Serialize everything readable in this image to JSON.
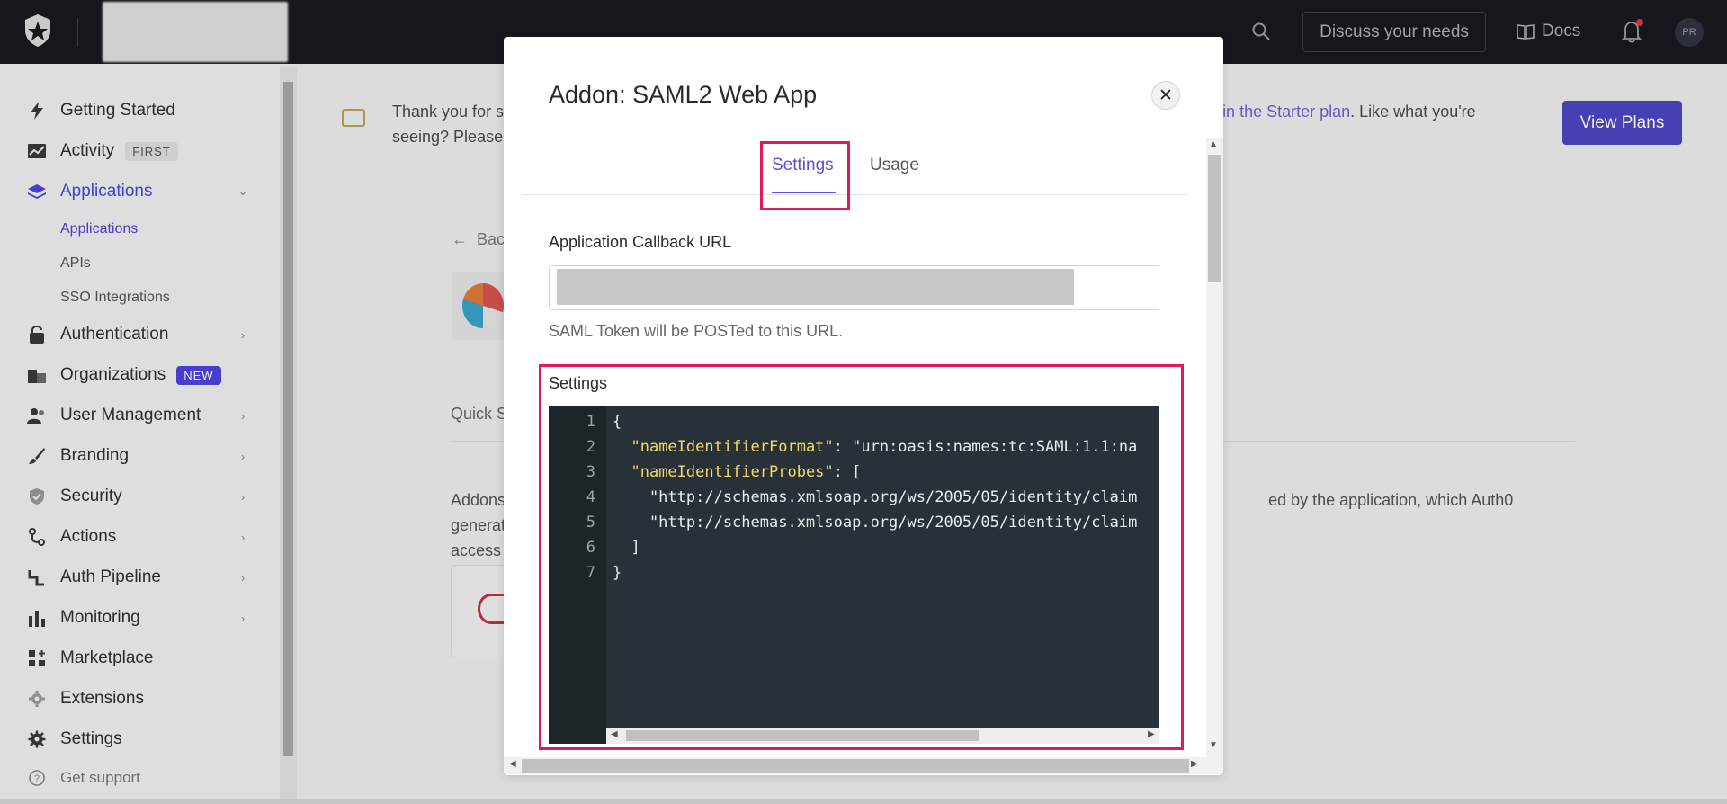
{
  "topbar": {
    "discuss_label": "Discuss your needs",
    "docs_label": "Docs",
    "avatar_initials": "PR"
  },
  "sidebar": {
    "items": [
      {
        "label": "Getting Started",
        "icon": "lightning-icon"
      },
      {
        "label": "Activity",
        "icon": "activity-icon",
        "badge": "FIRST"
      },
      {
        "label": "Applications",
        "icon": "layers-icon",
        "active": true,
        "expanded": true
      },
      {
        "label": "Authentication",
        "icon": "lock-icon"
      },
      {
        "label": "Organizations",
        "icon": "building-icon",
        "badge": "NEW"
      },
      {
        "label": "User Management",
        "icon": "users-icon"
      },
      {
        "label": "Branding",
        "icon": "brush-icon"
      },
      {
        "label": "Security",
        "icon": "shield-icon"
      },
      {
        "label": "Actions",
        "icon": "actions-icon"
      },
      {
        "label": "Auth Pipeline",
        "icon": "pipeline-icon"
      },
      {
        "label": "Monitoring",
        "icon": "bar-chart-icon"
      },
      {
        "label": "Marketplace",
        "icon": "grid-plus-icon"
      },
      {
        "label": "Extensions",
        "icon": "gear-icon"
      },
      {
        "label": "Settings",
        "icon": "settings-icon"
      },
      {
        "label": "Get support",
        "icon": "help-icon"
      }
    ],
    "sub_items": [
      "Applications",
      "APIs",
      "SSO Integrations"
    ]
  },
  "background": {
    "banner_text_start": "Thank you for s",
    "banner_link": "in the Starter plan",
    "banner_text_end": ". Like what you're",
    "banner_line2": "seeing? Please",
    "view_plans_label": "View Plans",
    "back_label": "Bac",
    "quick_start_label": "Quick S",
    "addons_line1": "Addons",
    "addons_line1_right": "ed by the application, which Auth0 generates",
    "addons_line2": "access"
  },
  "modal": {
    "title": "Addon: SAML2 Web App",
    "tabs": [
      {
        "label": "Settings",
        "active": true
      },
      {
        "label": "Usage"
      }
    ],
    "callback_label": "Application Callback URL",
    "callback_help": "SAML Token will be POSTed to this URL.",
    "settings_label": "Settings",
    "code_lines": [
      {
        "n": "1",
        "text": "{"
      },
      {
        "n": "2",
        "key": "\"nameIdentifierFormat\"",
        "rest": ": \"urn:oasis:names:tc:SAML:1.1:na"
      },
      {
        "n": "3",
        "key": "\"nameIdentifierProbes\"",
        "rest": ": ["
      },
      {
        "n": "4",
        "text": "    \"http://schemas.xmlsoap.org/ws/2005/05/identity/claim"
      },
      {
        "n": "5",
        "text": "    \"http://schemas.xmlsoap.org/ws/2005/05/identity/claim"
      },
      {
        "n": "6",
        "text": "  ]"
      },
      {
        "n": "7",
        "text": "}"
      }
    ]
  },
  "colors": {
    "accent": "#4f44e0",
    "highlight": "#e0195a",
    "topbar": "#171a1f",
    "editor_bg": "#283137",
    "json_key": "#f3d86a"
  }
}
